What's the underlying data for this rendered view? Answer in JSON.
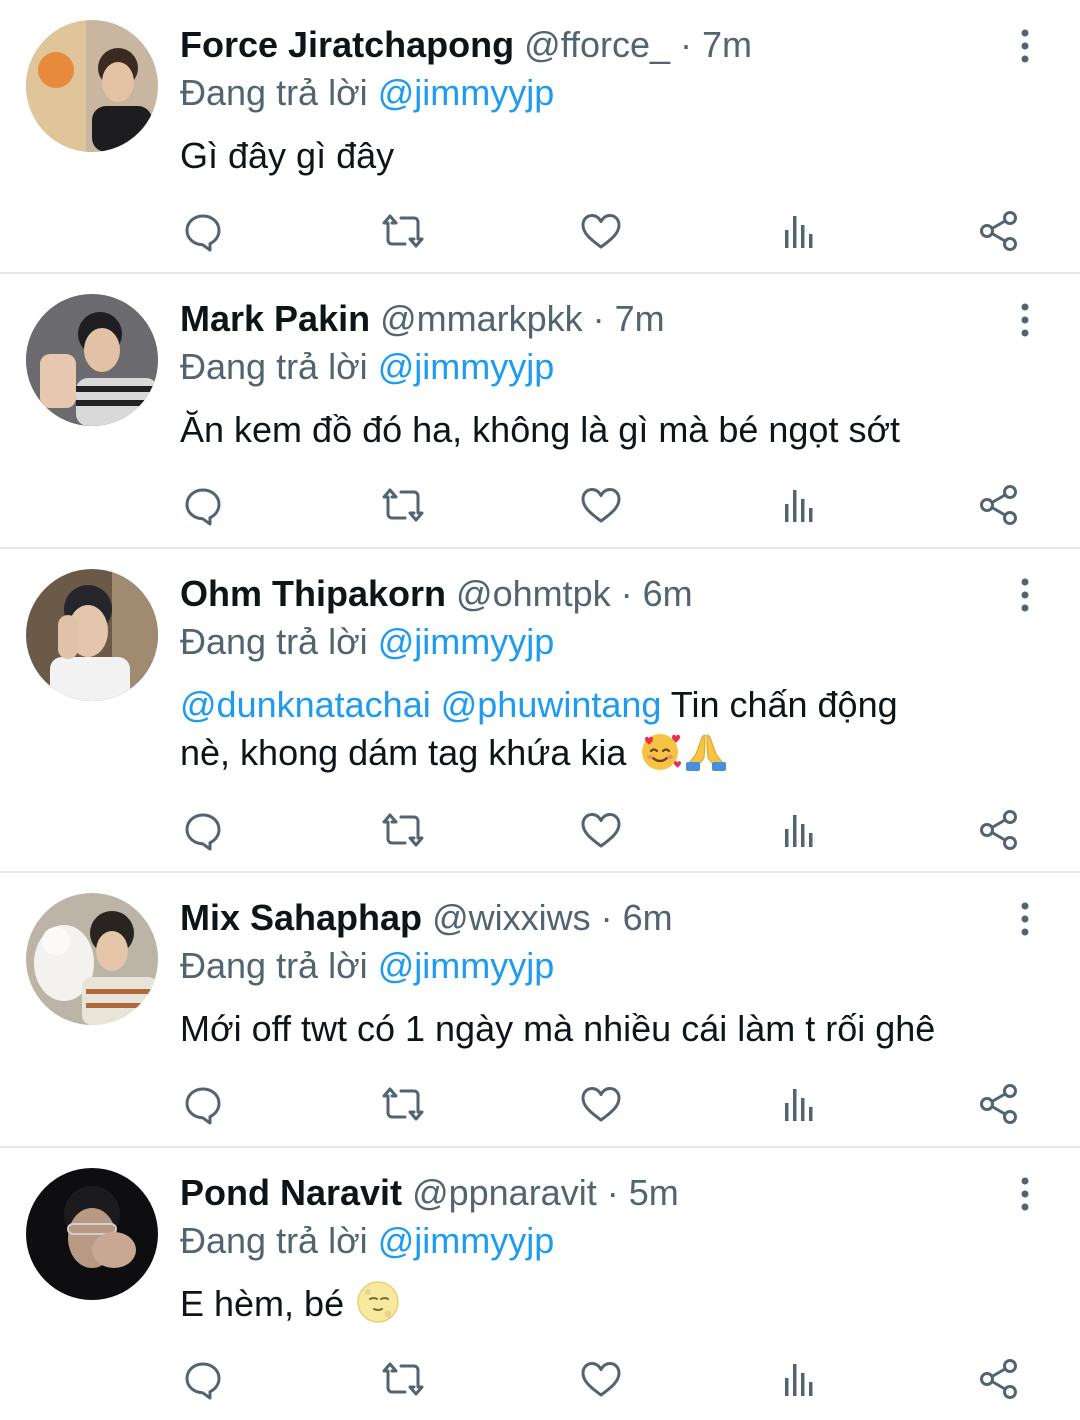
{
  "colors": {
    "accent": "#1d9bf0",
    "secondary_text": "#536471",
    "primary_text": "#0f1419",
    "divider": "#e3e8ec"
  },
  "replying_label": "Đang trả lời",
  "tweets": [
    {
      "name": "Force Jiratchapong",
      "meta": "@fforce_ · 7m",
      "reply_to": "@jimmyyjp",
      "text": "Gì đây gì đây"
    },
    {
      "name": "Mark Pakin",
      "meta": "@mmarkpkk · 7m",
      "reply_to": "@jimmyyjp",
      "text": "Ăn kem đồ đó ha, không là gì mà bé ngọt sớt"
    },
    {
      "name": "Ohm Thipakorn",
      "meta": "@ohmtpk · 6m",
      "reply_to": "@jimmyyjp",
      "mention1": "@dunknatachai",
      "mention2": "@phuwintang",
      "text_part1": "Tin chấn động",
      "text_part2": "nè, khong dám tag khứa kia",
      "emojis": [
        "smiling-face-with-hearts-emoji",
        "folded-hands-emoji"
      ]
    },
    {
      "name": "Mix Sahaphap",
      "meta": "@wixxiws · 6m",
      "reply_to": "@jimmyyjp",
      "text": "Mới off twt có 1 ngày mà nhiều cái làm t rối ghê"
    },
    {
      "name": "Pond Naravit",
      "meta": "@ppnaravit · 5m",
      "reply_to": "@jimmyyjp",
      "text": "E hèm, bé",
      "emojis": [
        "moon-face-emoji"
      ]
    }
  ]
}
